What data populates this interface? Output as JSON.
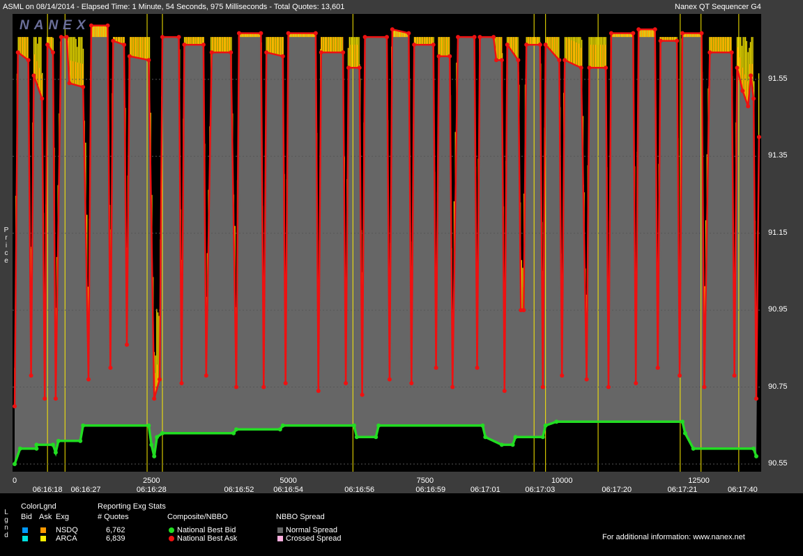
{
  "header": {
    "title": "ASML on 08/14/2014  -  Elapsed Time: 1 Minute, 54 Seconds, 975 Milliseconds  -  Total Quotes: 13,601",
    "app": "Nanex QT Sequencer G4",
    "logo": "NANEX"
  },
  "side_labels": {
    "price": "Price",
    "legend": "Lgnd"
  },
  "colors": {
    "bid": "#22dd22",
    "ask": "#ee1111",
    "arca": "#ffee00",
    "nsdq": "#ff9900",
    "normal_spread": "#666666",
    "crossed_spread": "#ffb0e0"
  },
  "legend": {
    "color_legend": "ColorLgnd",
    "col_bid": "Bid",
    "col_ask": "Ask",
    "col_exg": "Exg",
    "exchanges": [
      {
        "name": "NSDQ",
        "quotes": "6,762",
        "bid_color": "#0099ff",
        "ask_color": "#ff9900"
      },
      {
        "name": "ARCA",
        "quotes": "6,839",
        "bid_color": "#00e0e0",
        "ask_color": "#ffee00"
      }
    ],
    "reporting": "Reporting Exg Stats",
    "quotes_hdr": "# Quotes",
    "composite": "Composite/NBBO",
    "nbb": "National Best Bid",
    "nbo": "National Best Ask",
    "spread": "NBBO Spread",
    "normal": "Normal Spread",
    "crossed": "Crossed Spread",
    "info": "For additional information: www.nanex.net"
  },
  "chart_data": {
    "type": "line",
    "ylabel": "Price",
    "ylim": [
      90.53,
      91.72
    ],
    "yticks": [
      90.55,
      90.75,
      90.95,
      91.15,
      91.35,
      91.55
    ],
    "xlim": [
      0,
      13601
    ],
    "xticks": [
      0,
      2500,
      5000,
      7500,
      10000,
      12500
    ],
    "time_labels": [
      {
        "x": 600,
        "label": "06:16:18"
      },
      {
        "x": 1300,
        "label": "06:16:27"
      },
      {
        "x": 2500,
        "label": "06:16:28"
      },
      {
        "x": 4100,
        "label": "06:16:52"
      },
      {
        "x": 5000,
        "label": "06:16:54"
      },
      {
        "x": 6300,
        "label": "06:16:56"
      },
      {
        "x": 7600,
        "label": "06:16:59"
      },
      {
        "x": 8600,
        "label": "06:17:01"
      },
      {
        "x": 9600,
        "label": "06:17:03"
      },
      {
        "x": 11000,
        "label": "06:17:20"
      },
      {
        "x": 12200,
        "label": "06:17:21"
      },
      {
        "x": 13300,
        "label": "06:17:40"
      }
    ],
    "series": [
      {
        "name": "National Best Bid",
        "points": [
          [
            0,
            90.55
          ],
          [
            100,
            90.59
          ],
          [
            400,
            90.59
          ],
          [
            400,
            90.6
          ],
          [
            700,
            90.6
          ],
          [
            750,
            90.58
          ],
          [
            800,
            90.61
          ],
          [
            1200,
            90.61
          ],
          [
            1250,
            90.65
          ],
          [
            2450,
            90.65
          ],
          [
            2500,
            90.6
          ],
          [
            2550,
            90.57
          ],
          [
            2600,
            90.62
          ],
          [
            2700,
            90.63
          ],
          [
            4000,
            90.63
          ],
          [
            4050,
            90.64
          ],
          [
            4850,
            90.64
          ],
          [
            4900,
            90.65
          ],
          [
            6200,
            90.65
          ],
          [
            6250,
            90.62
          ],
          [
            6600,
            90.62
          ],
          [
            6650,
            90.65
          ],
          [
            8550,
            90.65
          ],
          [
            8600,
            90.62
          ],
          [
            8900,
            90.6
          ],
          [
            9100,
            90.6
          ],
          [
            9150,
            90.62
          ],
          [
            9650,
            90.62
          ],
          [
            9700,
            90.65
          ],
          [
            9900,
            90.66
          ],
          [
            12200,
            90.66
          ],
          [
            12250,
            90.63
          ],
          [
            12400,
            90.59
          ],
          [
            13500,
            90.59
          ],
          [
            13550,
            90.57
          ]
        ]
      },
      {
        "name": "National Best Ask",
        "points": [
          [
            0,
            90.7
          ],
          [
            60,
            91.62
          ],
          [
            250,
            91.6
          ],
          [
            300,
            90.78
          ],
          [
            350,
            91.56
          ],
          [
            500,
            91.5
          ],
          [
            550,
            90.72
          ],
          [
            600,
            91.64
          ],
          [
            700,
            91.62
          ],
          [
            750,
            90.72
          ],
          [
            850,
            91.66
          ],
          [
            950,
            91.66
          ],
          [
            1000,
            91.54
          ],
          [
            1250,
            91.53
          ],
          [
            1350,
            90.77
          ],
          [
            1400,
            91.69
          ],
          [
            1700,
            91.69
          ],
          [
            1750,
            90.8
          ],
          [
            1800,
            91.65
          ],
          [
            2000,
            91.64
          ],
          [
            2050,
            90.86
          ],
          [
            2100,
            91.61
          ],
          [
            2450,
            91.6
          ],
          [
            2550,
            90.72
          ],
          [
            2650,
            90.77
          ],
          [
            2700,
            91.66
          ],
          [
            3000,
            91.66
          ],
          [
            3050,
            90.76
          ],
          [
            3100,
            91.64
          ],
          [
            3450,
            91.64
          ],
          [
            3500,
            90.78
          ],
          [
            3600,
            91.62
          ],
          [
            3950,
            91.62
          ],
          [
            4050,
            90.75
          ],
          [
            4100,
            91.67
          ],
          [
            4500,
            91.67
          ],
          [
            4550,
            90.75
          ],
          [
            4600,
            91.62
          ],
          [
            4900,
            91.61
          ],
          [
            4950,
            90.76
          ],
          [
            5000,
            91.67
          ],
          [
            5500,
            91.67
          ],
          [
            5550,
            90.74
          ],
          [
            5600,
            91.62
          ],
          [
            6000,
            91.62
          ],
          [
            6050,
            90.76
          ],
          [
            6100,
            91.58
          ],
          [
            6300,
            91.58
          ],
          [
            6350,
            90.73
          ],
          [
            6400,
            91.66
          ],
          [
            6800,
            91.66
          ],
          [
            6850,
            90.77
          ],
          [
            6900,
            91.68
          ],
          [
            7200,
            91.67
          ],
          [
            7250,
            90.76
          ],
          [
            7300,
            91.64
          ],
          [
            7650,
            91.64
          ],
          [
            7700,
            90.8
          ],
          [
            7750,
            91.61
          ],
          [
            7950,
            91.61
          ],
          [
            8000,
            90.75
          ],
          [
            8100,
            91.66
          ],
          [
            8400,
            91.66
          ],
          [
            8450,
            90.8
          ],
          [
            8500,
            91.66
          ],
          [
            8750,
            91.66
          ],
          [
            8800,
            91.6
          ],
          [
            8900,
            91.6
          ],
          [
            8950,
            90.74
          ],
          [
            9000,
            91.64
          ],
          [
            9200,
            91.6
          ],
          [
            9250,
            90.95
          ],
          [
            9300,
            90.95
          ],
          [
            9350,
            91.64
          ],
          [
            9600,
            91.64
          ],
          [
            9650,
            90.75
          ],
          [
            9700,
            91.64
          ],
          [
            9950,
            91.6
          ],
          [
            10000,
            90.78
          ],
          [
            10050,
            91.6
          ],
          [
            10350,
            91.58
          ],
          [
            10450,
            90.77
          ],
          [
            10500,
            91.58
          ],
          [
            10800,
            91.58
          ],
          [
            10850,
            90.75
          ],
          [
            10900,
            91.67
          ],
          [
            11300,
            91.67
          ],
          [
            11350,
            90.76
          ],
          [
            11400,
            91.68
          ],
          [
            11700,
            91.68
          ],
          [
            11750,
            90.8
          ],
          [
            11800,
            91.65
          ],
          [
            12100,
            91.65
          ],
          [
            12150,
            90.78
          ],
          [
            12200,
            91.67
          ],
          [
            12550,
            91.67
          ],
          [
            12600,
            90.75
          ],
          [
            12700,
            91.62
          ],
          [
            13100,
            91.62
          ],
          [
            13150,
            90.78
          ],
          [
            13200,
            91.58
          ],
          [
            13300,
            91.52
          ],
          [
            13400,
            91.48
          ],
          [
            13450,
            91.56
          ],
          [
            13500,
            91.5
          ],
          [
            13550,
            90.72
          ],
          [
            13600,
            91.4
          ]
        ]
      }
    ],
    "arca_lines": [
      600,
      920,
      2420,
      2700,
      6180,
      9490,
      9700,
      10660,
      12160,
      12540,
      13230
    ]
  }
}
